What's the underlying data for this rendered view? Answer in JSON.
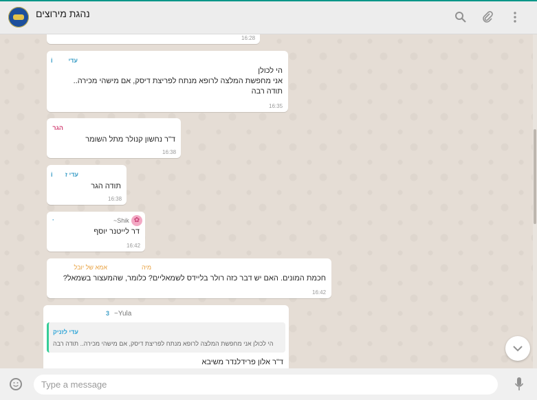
{
  "header": {
    "title": "נהגת מירוצים",
    "avatar_alt": "group-avatar"
  },
  "messages": [
    {
      "time": "16:28"
    },
    {
      "sender": "עדי",
      "sender_suffix": "i",
      "lines": [
        "הי לכולן",
        "אני מחפשת המלצה לרופא מנתח לפריצת דיסק, אם מישהי מכירה..",
        "תודה רבה"
      ],
      "time": "16:35"
    },
    {
      "sender": "הגר",
      "lines": [
        "ד\"ר נחשון קנולר מתל השומר"
      ],
      "time": "16:38"
    },
    {
      "sender": "עדי ז",
      "sender_suffix": "i",
      "lines": [
        "תודה הגר"
      ],
      "time": "16:38"
    },
    {
      "sender": "~Shik",
      "sender_dot": "·",
      "lines": [
        "דר לייטנר יוסף"
      ],
      "time": "16:42"
    },
    {
      "sender": "מיה",
      "sender_extra": "אמא של יובל",
      "lines": [
        "חכמת המונים.  האם יש דבר כזה רולר בליידס לשמאליים?  כלומר,  שהמעצור בשמאל?"
      ],
      "time": "16:42"
    },
    {
      "sender": "~Yula",
      "sender_extra": "3",
      "quote_sender": "עדי לזניק",
      "quote_text": "הי לכולן אני מחפשת המלצה לרופא מנתח לפריצת דיסק, אם מישהי מכירה.. תודה רבה",
      "lines": [
        "ד\"ר אלון פרידלנדר משיבא"
      ]
    }
  ],
  "footer": {
    "placeholder": "Type a message"
  },
  "colors": {
    "chat_bg": "#e5ddd5",
    "header_bg": "#ededed",
    "accent": "#009688",
    "bubble": "#ffffff"
  },
  "icons": [
    "search-icon",
    "attach-icon",
    "menu-icon",
    "emoji-icon",
    "mic-icon",
    "chevron-down-icon",
    "flower-icon"
  ]
}
